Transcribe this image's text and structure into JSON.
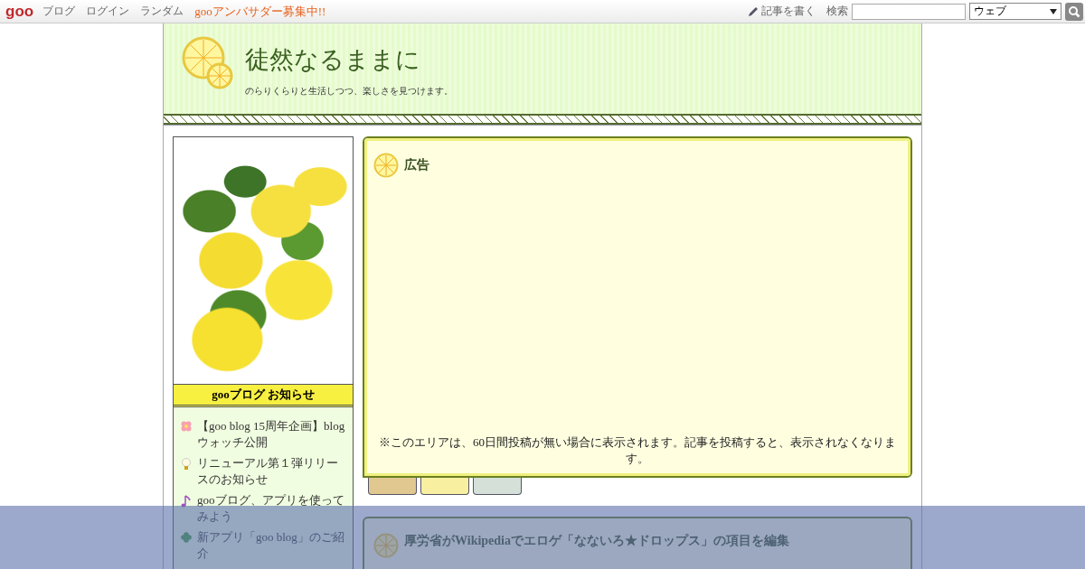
{
  "topbar": {
    "logo": "goo",
    "links": [
      "ブログ",
      "ログイン",
      "ランダム"
    ],
    "promo": "gooアンバサダー募集中!!",
    "write": "記事を書く",
    "search_label": "検索",
    "search_scope": "ウェブ"
  },
  "header": {
    "title": "徒然なるままに",
    "subtitle": "のらりくらりと生活しつつ、楽しさを見つけます。"
  },
  "sidebar": {
    "notice_title": "gooブログ お知らせ",
    "notices": [
      {
        "kind": "flower",
        "text": "【goo blog 15周年企画】blogウォッチ公開"
      },
      {
        "kind": "bulb",
        "text": "リニューアル第１弾リリースのお知らせ"
      },
      {
        "kind": "note",
        "text": "gooブログ、アプリを使ってみよう"
      },
      {
        "kind": "clover",
        "text": "新アプリ「goo blog」のご紹介"
      }
    ]
  },
  "ad_box": {
    "title": "広告",
    "note": "※このエリアは、60日間投稿が無い場合に表示されます。記事を投稿すると、表示されなくなります。",
    "tabs": [
      {
        "color": "#e0c890"
      },
      {
        "color": "#f8f0a0"
      },
      {
        "color": "#d4e0d8"
      }
    ]
  },
  "article": {
    "title": "厚労省がWikipediaでエロゲ「なないろ★ドロップス」の項目を編集"
  }
}
